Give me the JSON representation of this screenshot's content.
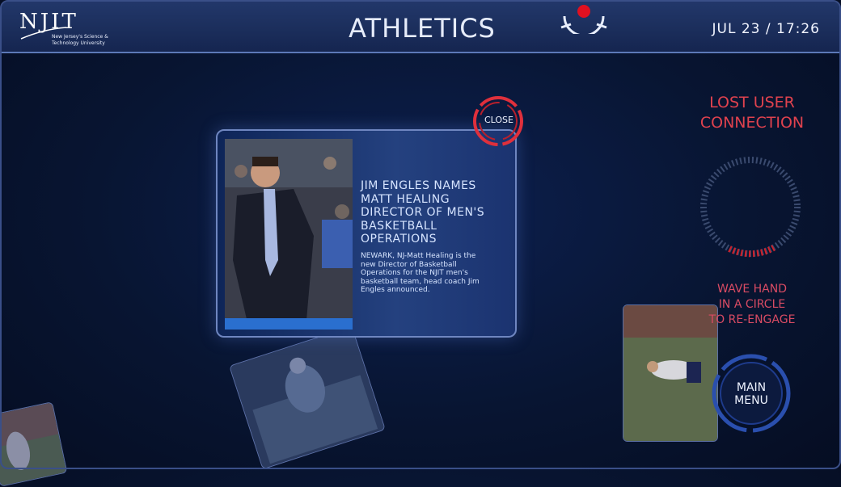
{
  "header": {
    "logo_text": "NJIT",
    "logo_sub": "New Jersey's Science & Technology University",
    "title": "ATHLETICS",
    "datetime": "JUL  23 / 17:26"
  },
  "article": {
    "headline": "JIM ENGLES NAMES MATT HEALING DIRECTOR OF MEN'S BASKETBALL OPERATIONS",
    "body": "NEWARK, NJ-Matt Healing is the new Director of Basketball Operations for the NJIT men's basketball team, head coach Jim Engles announced.",
    "close_label": "CLOSE"
  },
  "status": {
    "lost_line1": "LOST USER",
    "lost_line2": "CONNECTION",
    "wave_line1": "WAVE HAND",
    "wave_line2": "IN A CIRCLE",
    "wave_line3": "TO RE-ENGAGE"
  },
  "menu": {
    "line1": "MAIN",
    "line2": "MENU"
  },
  "colors": {
    "accent_red": "#e0424e",
    "ring_blue": "#2f56b8",
    "background": "#081532"
  }
}
